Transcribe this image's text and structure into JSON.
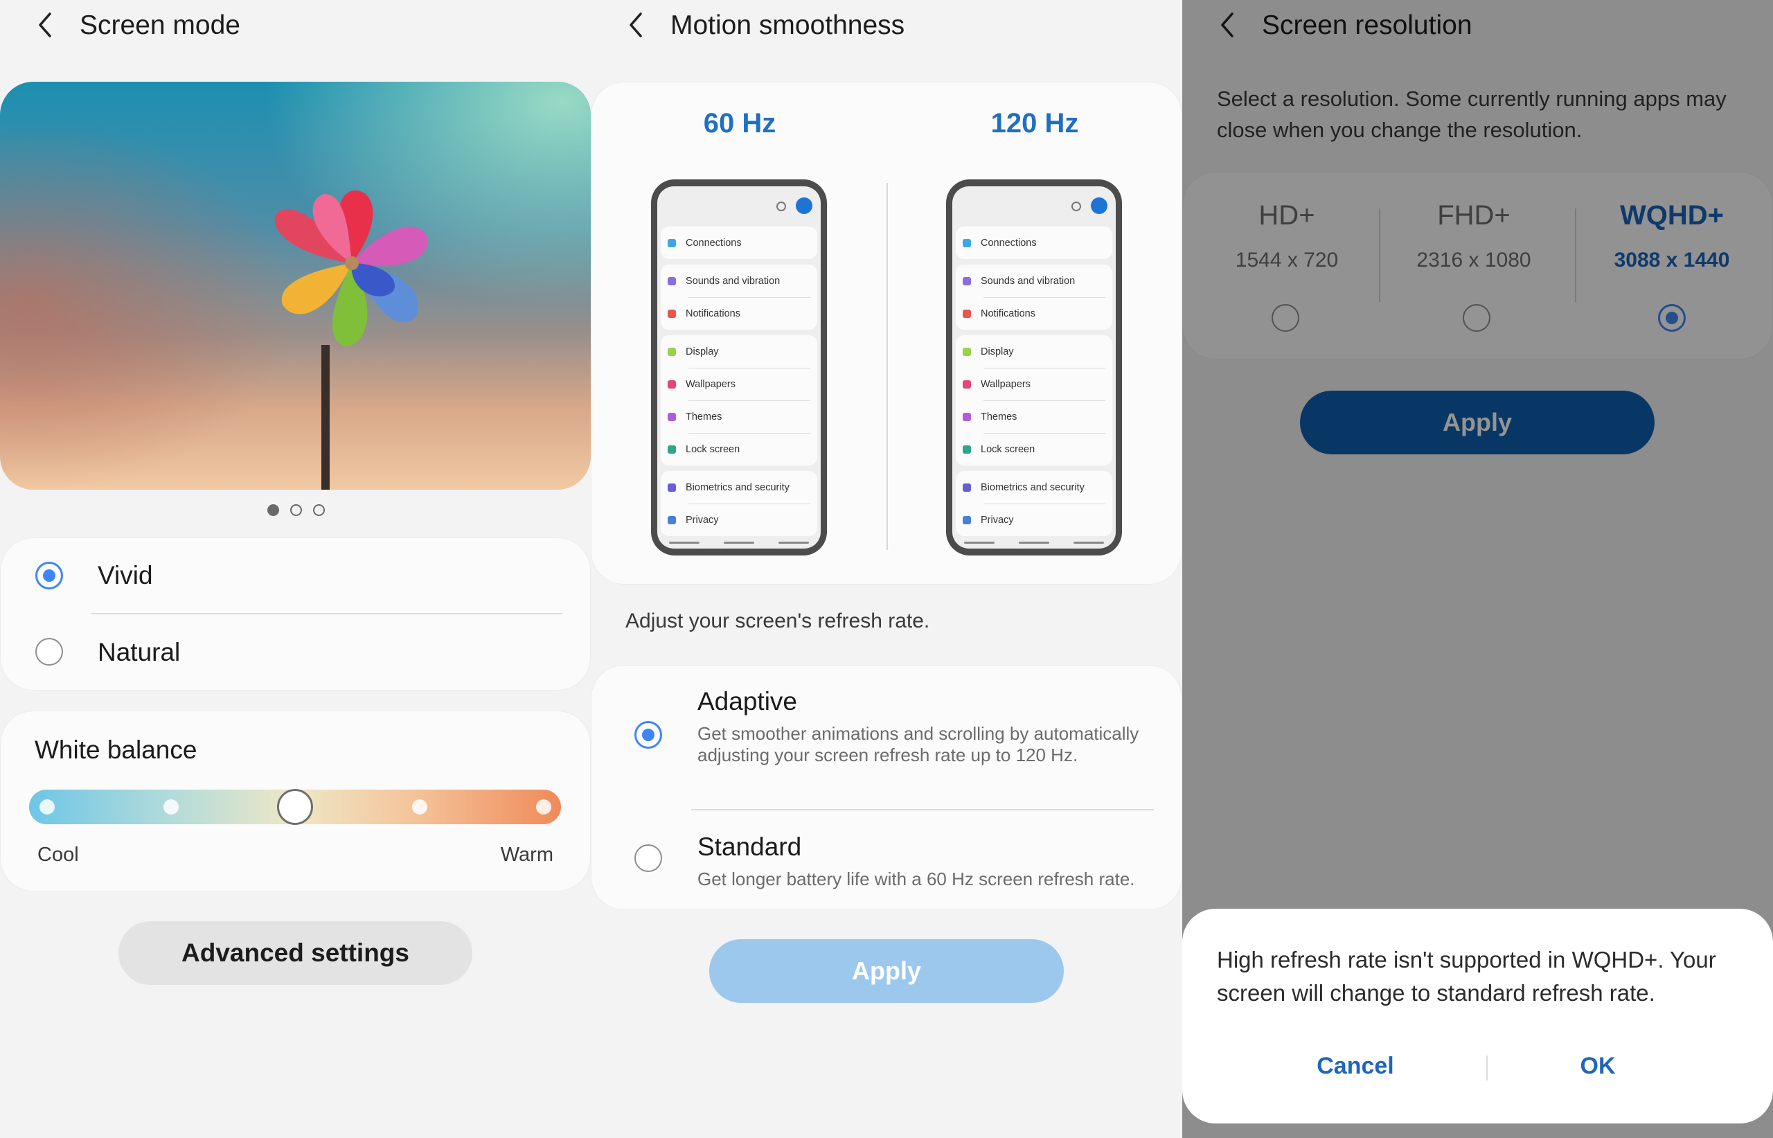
{
  "colors": {
    "accent": "#3e86f5",
    "link_blue": "#1f6fc3",
    "dark_blue": "#0f5fb0"
  },
  "screen_mode": {
    "title": "Screen mode",
    "carousel_page": 1,
    "carousel_total": 3,
    "options": [
      {
        "label": "Vivid",
        "selected": true
      },
      {
        "label": "Natural",
        "selected": false
      }
    ],
    "white_balance": {
      "title": "White balance",
      "min_label": "Cool",
      "max_label": "Warm",
      "level": 0.5
    },
    "advanced_settings_label": "Advanced settings"
  },
  "motion_smoothness": {
    "title": "Motion smoothness",
    "rate_60": "60 Hz",
    "rate_120": "120 Hz",
    "phone_menu": [
      "Connections",
      "Sounds and vibration",
      "Notifications",
      "Display",
      "Wallpapers",
      "Themes",
      "Lock screen",
      "Biometrics and security",
      "Privacy"
    ],
    "description": "Adjust your screen's refresh rate.",
    "options": [
      {
        "label": "Adaptive",
        "desc": "Get smoother animations and scrolling by automatically adjusting your screen refresh rate up to 120 Hz.",
        "selected": true
      },
      {
        "label": "Standard",
        "desc": "Get longer battery life with a 60 Hz screen refresh rate.",
        "selected": false
      }
    ],
    "apply_label": "Apply"
  },
  "screen_resolution": {
    "title": "Screen resolution",
    "description": "Select a resolution. Some currently running apps may close when you change the resolution.",
    "options": [
      {
        "name": "HD+",
        "res": "1544 x 720",
        "selected": false
      },
      {
        "name": "FHD+",
        "res": "2316 x 1080",
        "selected": false
      },
      {
        "name": "WQHD+",
        "res": "3088 x 1440",
        "selected": true
      }
    ],
    "apply_label": "Apply",
    "dialog": {
      "message": "High refresh rate isn't supported in WQHD+. Your screen will change to standard refresh rate.",
      "cancel": "Cancel",
      "ok": "OK"
    }
  }
}
